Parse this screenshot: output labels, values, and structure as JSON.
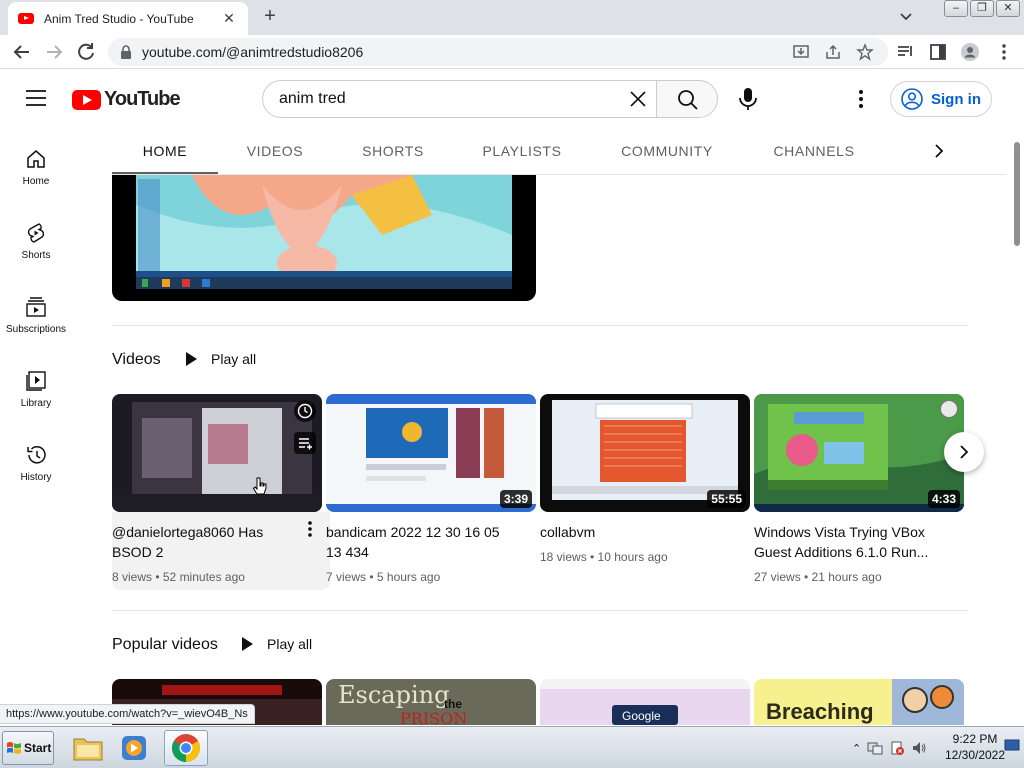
{
  "browser": {
    "tab_title": "Anim Tred Studio - YouTube",
    "new_tab": "+",
    "url": "youtube.com/@animtredstudio8206",
    "status_url": "https://www.youtube.com/watch?v=_wievO4B_Ns"
  },
  "masthead": {
    "logo_text": "YouTube",
    "search_value": "anim tred",
    "signin_label": "Sign in"
  },
  "guide": [
    {
      "label": "Home",
      "icon": "home-icon"
    },
    {
      "label": "Shorts",
      "icon": "shorts-icon"
    },
    {
      "label": "Subscriptions",
      "icon": "subscriptions-icon"
    },
    {
      "label": "Library",
      "icon": "library-icon"
    },
    {
      "label": "History",
      "icon": "history-icon"
    }
  ],
  "channel_tabs": [
    "HOME",
    "VIDEOS",
    "SHORTS",
    "PLAYLISTS",
    "COMMUNITY",
    "CHANNELS"
  ],
  "videos_shelf": {
    "title": "Videos",
    "play_all": "Play all",
    "items": [
      {
        "title": "@danielortega8060 Has BSOD 2",
        "meta": "8 views • 52 minutes ago",
        "duration": ""
      },
      {
        "title": "bandicam 2022 12 30 16 05 13 434",
        "meta": "7 views • 5 hours ago",
        "duration": "3:39"
      },
      {
        "title": "collabvm",
        "meta": "18 views • 10 hours ago",
        "duration": "55:55"
      },
      {
        "title": "Windows Vista Trying VBox Guest Additions 6.1.0 Run...",
        "meta": "27 views • 21 hours ago",
        "duration": "4:33"
      }
    ]
  },
  "popular_shelf": {
    "title": "Popular videos",
    "play_all": "Play all",
    "thumb_texts": [
      "Escaping",
      "the",
      "PRISON",
      "Google",
      "Breaching"
    ]
  },
  "taskbar": {
    "start_label": "Start",
    "time": "9:22 PM",
    "date": "12/30/2022"
  },
  "colors": {
    "youtube_red": "#ff0000",
    "link_blue": "#065fd4"
  }
}
